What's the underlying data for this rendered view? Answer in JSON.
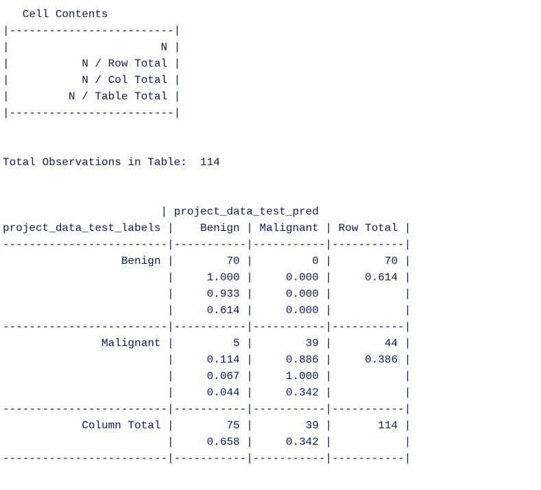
{
  "theme": {
    "text_color": "#0a1a6a",
    "background": "#ffffff"
  },
  "cell_contents_legend": {
    "lines": [
      "   Cell Contents",
      "|-------------------------|",
      "|                       N |",
      "|           N / Row Total |",
      "|           N / Col Total |",
      "|         N / Table Total |",
      "|-------------------------|"
    ]
  },
  "total_observations": {
    "line": "Total Observations in Table:  114"
  },
  "crosstab": {
    "lines": [
      "                        | project_data_test_pred ",
      "project_data_test_labels |    Benign | Malignant | Row Total | ",
      "-------------------------|-----------|-----------|-----------|",
      "                  Benign |        70 |         0 |        70 | ",
      "                         |     1.000 |     0.000 |     0.614 | ",
      "                         |     0.933 |     0.000 |           | ",
      "                         |     0.614 |     0.000 |           | ",
      "-------------------------|-----------|-----------|-----------|",
      "               Malignant |         5 |        39 |        44 | ",
      "                         |     0.114 |     0.886 |     0.386 | ",
      "                         |     0.067 |     1.000 |           | ",
      "                         |     0.044 |     0.342 |           | ",
      "-------------------------|-----------|-----------|-----------|",
      "            Column Total |        75 |        39 |       114 | ",
      "                         |     0.658 |     0.342 |           | ",
      "-------------------------|-----------|-----------|-----------|"
    ]
  }
}
